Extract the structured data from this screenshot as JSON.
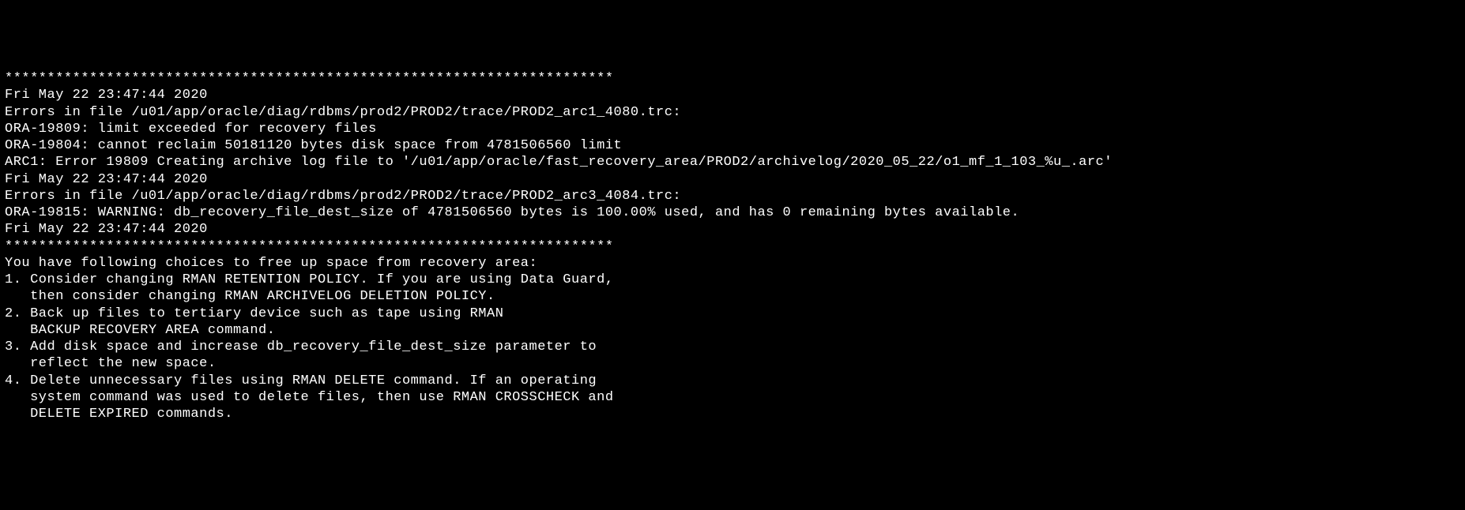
{
  "terminal": {
    "lines": [
      "************************************************************************",
      "Fri May 22 23:47:44 2020",
      "Errors in file /u01/app/oracle/diag/rdbms/prod2/PROD2/trace/PROD2_arc1_4080.trc:",
      "ORA-19809: limit exceeded for recovery files",
      "ORA-19804: cannot reclaim 50181120 bytes disk space from 4781506560 limit",
      "ARC1: Error 19809 Creating archive log file to '/u01/app/oracle/fast_recovery_area/PROD2/archivelog/2020_05_22/o1_mf_1_103_%u_.arc'",
      "Fri May 22 23:47:44 2020",
      "Errors in file /u01/app/oracle/diag/rdbms/prod2/PROD2/trace/PROD2_arc3_4084.trc:",
      "ORA-19815: WARNING: db_recovery_file_dest_size of 4781506560 bytes is 100.00% used, and has 0 remaining bytes available.",
      "Fri May 22 23:47:44 2020",
      "************************************************************************",
      "You have following choices to free up space from recovery area:",
      "1. Consider changing RMAN RETENTION POLICY. If you are using Data Guard,",
      "   then consider changing RMAN ARCHIVELOG DELETION POLICY.",
      "2. Back up files to tertiary device such as tape using RMAN",
      "   BACKUP RECOVERY AREA command.",
      "3. Add disk space and increase db_recovery_file_dest_size parameter to",
      "   reflect the new space.",
      "4. Delete unnecessary files using RMAN DELETE command. If an operating",
      "   system command was used to delete files, then use RMAN CROSSCHECK and",
      "   DELETE EXPIRED commands."
    ]
  }
}
